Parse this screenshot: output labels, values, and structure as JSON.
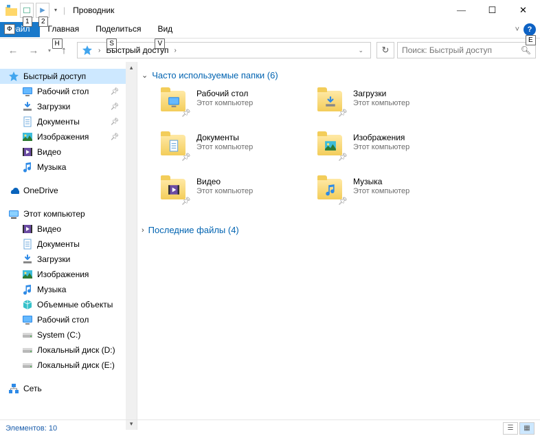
{
  "window": {
    "title": "Проводник",
    "key_tips": {
      "qat1": "1",
      "qat2": "2",
      "file": "Ф",
      "home": "H",
      "share": "S",
      "view": "V",
      "help": "E"
    }
  },
  "ribbon": {
    "file": "Файл",
    "home": "Главная",
    "share": "Поделиться",
    "view": "Вид"
  },
  "address": {
    "location": "Быстрый доступ",
    "search_placeholder": "Поиск: Быстрый доступ"
  },
  "sidebar": {
    "quick_access": "Быстрый доступ",
    "qa_items": [
      {
        "label": "Рабочий стол",
        "icon": "desktop",
        "pinned": true
      },
      {
        "label": "Загрузки",
        "icon": "downloads",
        "pinned": true
      },
      {
        "label": "Документы",
        "icon": "documents",
        "pinned": true
      },
      {
        "label": "Изображения",
        "icon": "pictures",
        "pinned": true
      },
      {
        "label": "Видео",
        "icon": "video",
        "pinned": false
      },
      {
        "label": "Музыка",
        "icon": "music",
        "pinned": false
      }
    ],
    "onedrive": "OneDrive",
    "this_pc": "Этот компьютер",
    "pc_items": [
      {
        "label": "Видео",
        "icon": "video"
      },
      {
        "label": "Документы",
        "icon": "documents"
      },
      {
        "label": "Загрузки",
        "icon": "downloads"
      },
      {
        "label": "Изображения",
        "icon": "pictures"
      },
      {
        "label": "Музыка",
        "icon": "music"
      },
      {
        "label": "Объемные объекты",
        "icon": "3d"
      },
      {
        "label": "Рабочий стол",
        "icon": "desktop"
      },
      {
        "label": "System (C:)",
        "icon": "drive"
      },
      {
        "label": "Локальный диск (D:)",
        "icon": "drive"
      },
      {
        "label": "Локальный диск (E:)",
        "icon": "drive"
      }
    ],
    "network": "Сеть"
  },
  "content": {
    "frequent_header": "Часто используемые папки (6)",
    "recent_header": "Последние файлы (4)",
    "location_label": "Этот компьютер",
    "frequent": [
      {
        "name": "Рабочий стол",
        "icon": "desktop"
      },
      {
        "name": "Загрузки",
        "icon": "downloads"
      },
      {
        "name": "Документы",
        "icon": "documents"
      },
      {
        "name": "Изображения",
        "icon": "pictures"
      },
      {
        "name": "Видео",
        "icon": "video"
      },
      {
        "name": "Музыка",
        "icon": "music"
      }
    ]
  },
  "statusbar": {
    "count": "Элементов: 10"
  }
}
